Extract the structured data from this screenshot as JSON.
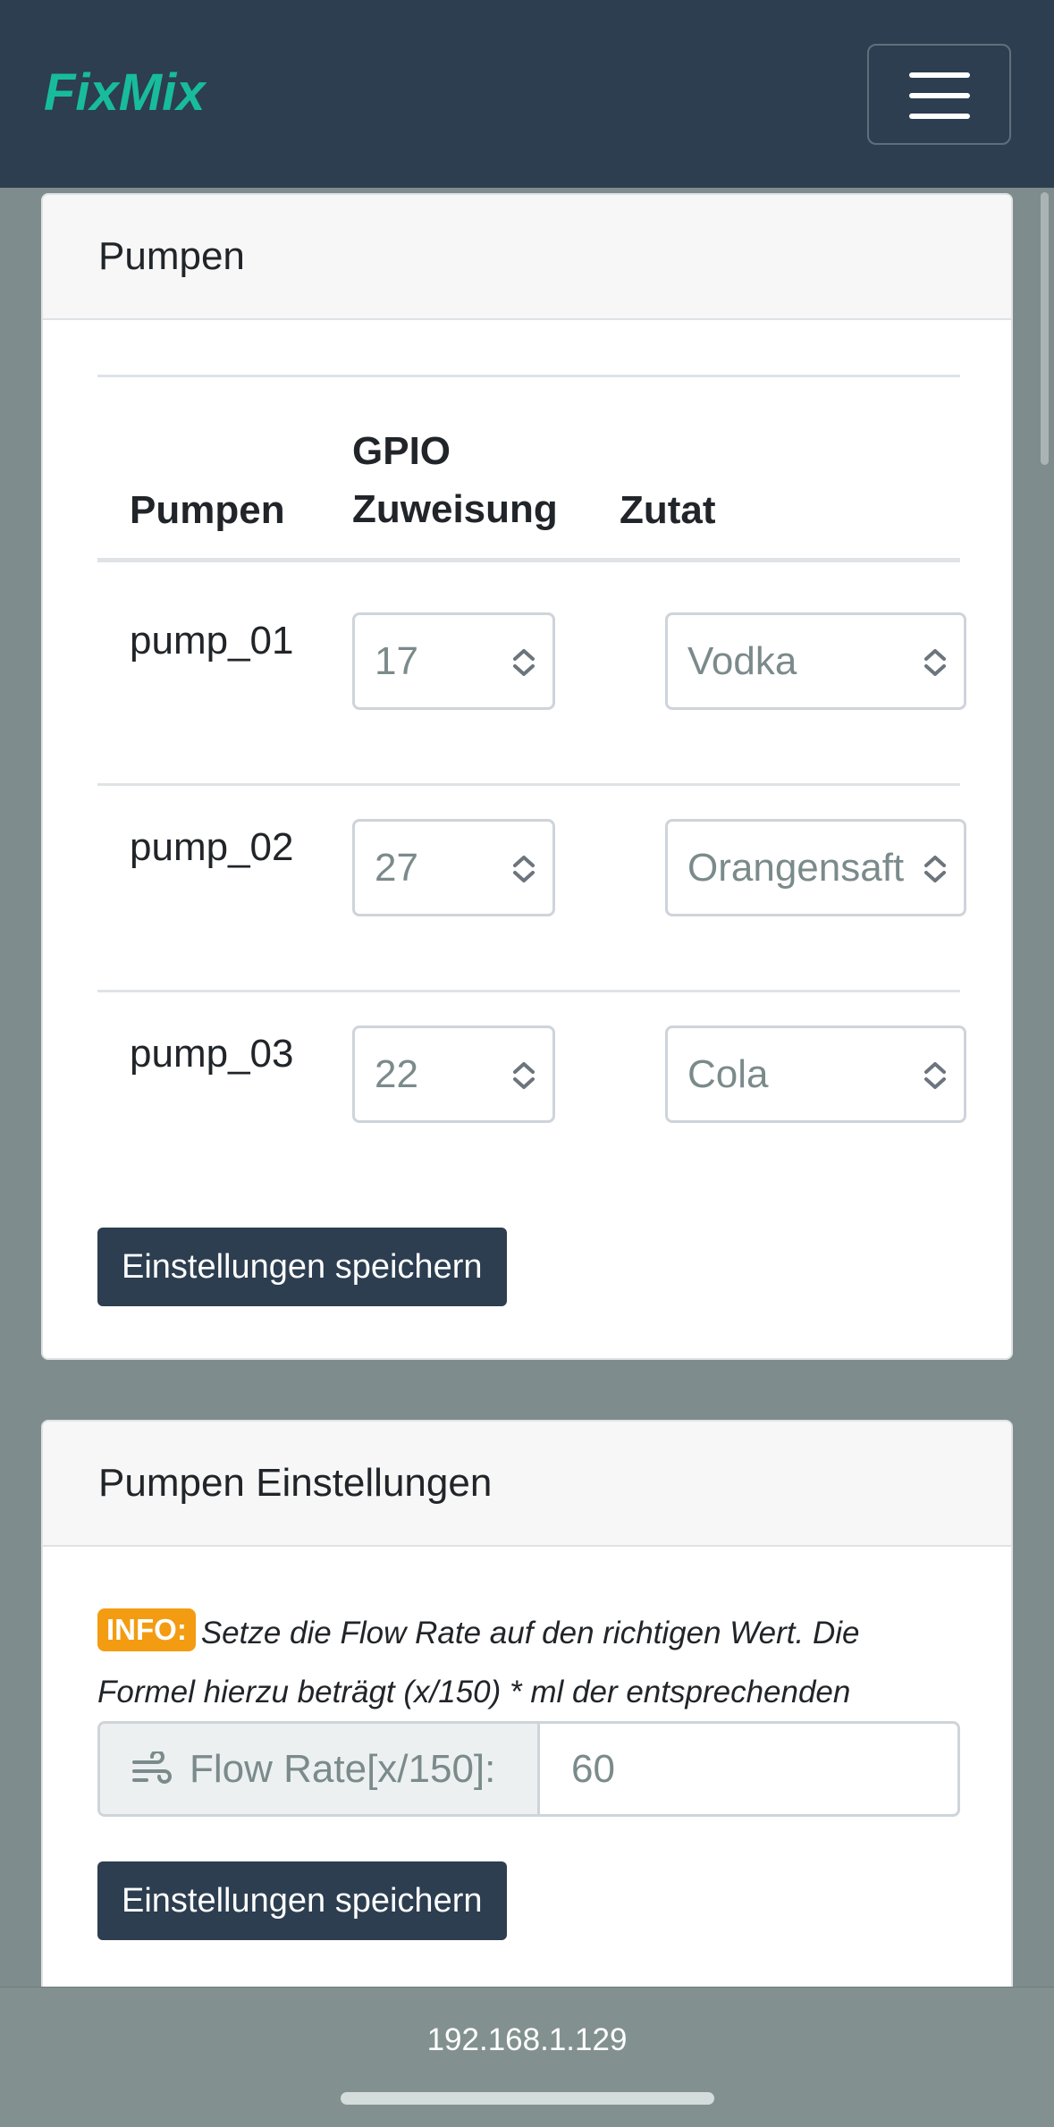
{
  "navbar": {
    "brand": "FixMix",
    "menu_icon": "hamburger-menu-icon"
  },
  "pumps_card": {
    "title": "Pumpen",
    "headers": {
      "pump": "Pumpen",
      "gpio_line1": "GPIO",
      "gpio_line2": "Zuweisung",
      "ingredient": "Zutat"
    },
    "rows": [
      {
        "name": "pump_01",
        "gpio": "17",
        "ingredient": "Vodka"
      },
      {
        "name": "pump_02",
        "gpio": "27",
        "ingredient": "Orangensaft"
      },
      {
        "name": "pump_03",
        "gpio": "22",
        "ingredient": "Cola"
      }
    ],
    "save_label": "Einstellungen speichern"
  },
  "settings_card": {
    "title": "Pumpen Einstellungen",
    "info_badge": "INFO:",
    "info_text": "Setze die Flow Rate auf den richtigen Wert. Die Formel hierzu beträgt (x/150) * ml der entsprechenden Flüssigkeit.",
    "flow_label": "Flow Rate[x/150]:",
    "flow_value": "60",
    "flow_icon": "wind-icon",
    "save_label": "Einstellungen speichern"
  },
  "browser": {
    "url": "192.168.1.129"
  },
  "colors": {
    "navbar": "#2c3e50",
    "brand": "#18bc9c",
    "badge": "#f39c12",
    "background": "#7f8c8d"
  }
}
